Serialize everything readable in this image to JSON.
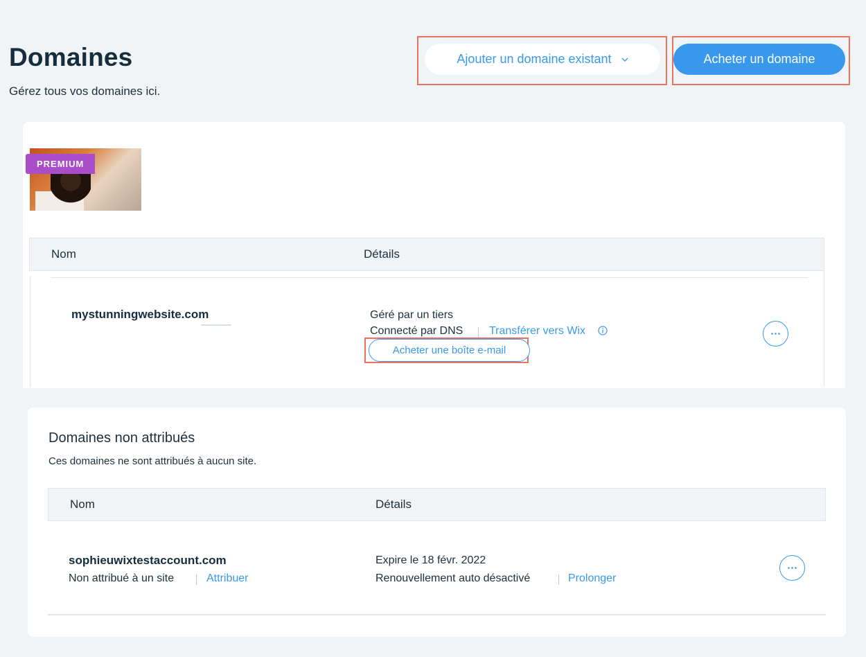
{
  "header": {
    "title": "Domaines",
    "subtitle": "Gérez tous vos domaines ici.",
    "add_existing_label": "Ajouter un domaine existant",
    "buy_domain_label": "Acheter un domaine"
  },
  "site_card": {
    "badge": "PREMIUM",
    "columns": {
      "name": "Nom",
      "details": "Détails"
    },
    "domain": {
      "name": "mystunningwebsite.com",
      "managed": "Géré par un tiers",
      "connection": "Connecté par DNS",
      "transfer_link": "Transférer vers Wix",
      "email_button": "Acheter une boîte e-mail",
      "more_label": "···"
    }
  },
  "unassigned": {
    "title": "Domaines non attribués",
    "subtitle": "Ces domaines ne sont attribués à aucun site.",
    "columns": {
      "name": "Nom",
      "details": "Détails"
    },
    "domain": {
      "name": "sophieuwixtestaccount.com",
      "status": "Non attribué à un site",
      "assign_link": "Attribuer",
      "expires": "Expire le 18 févr. 2022",
      "renewal": "Renouvellement auto désactivé",
      "extend_link": "Prolonger",
      "more_label": "···"
    }
  },
  "colors": {
    "accent": "#3899ec",
    "premium": "#aa4dc8",
    "highlight": "#e8735a",
    "background": "#f0f4f7"
  },
  "icons": [
    "chevron-down-icon",
    "info-icon",
    "more-icon"
  ]
}
